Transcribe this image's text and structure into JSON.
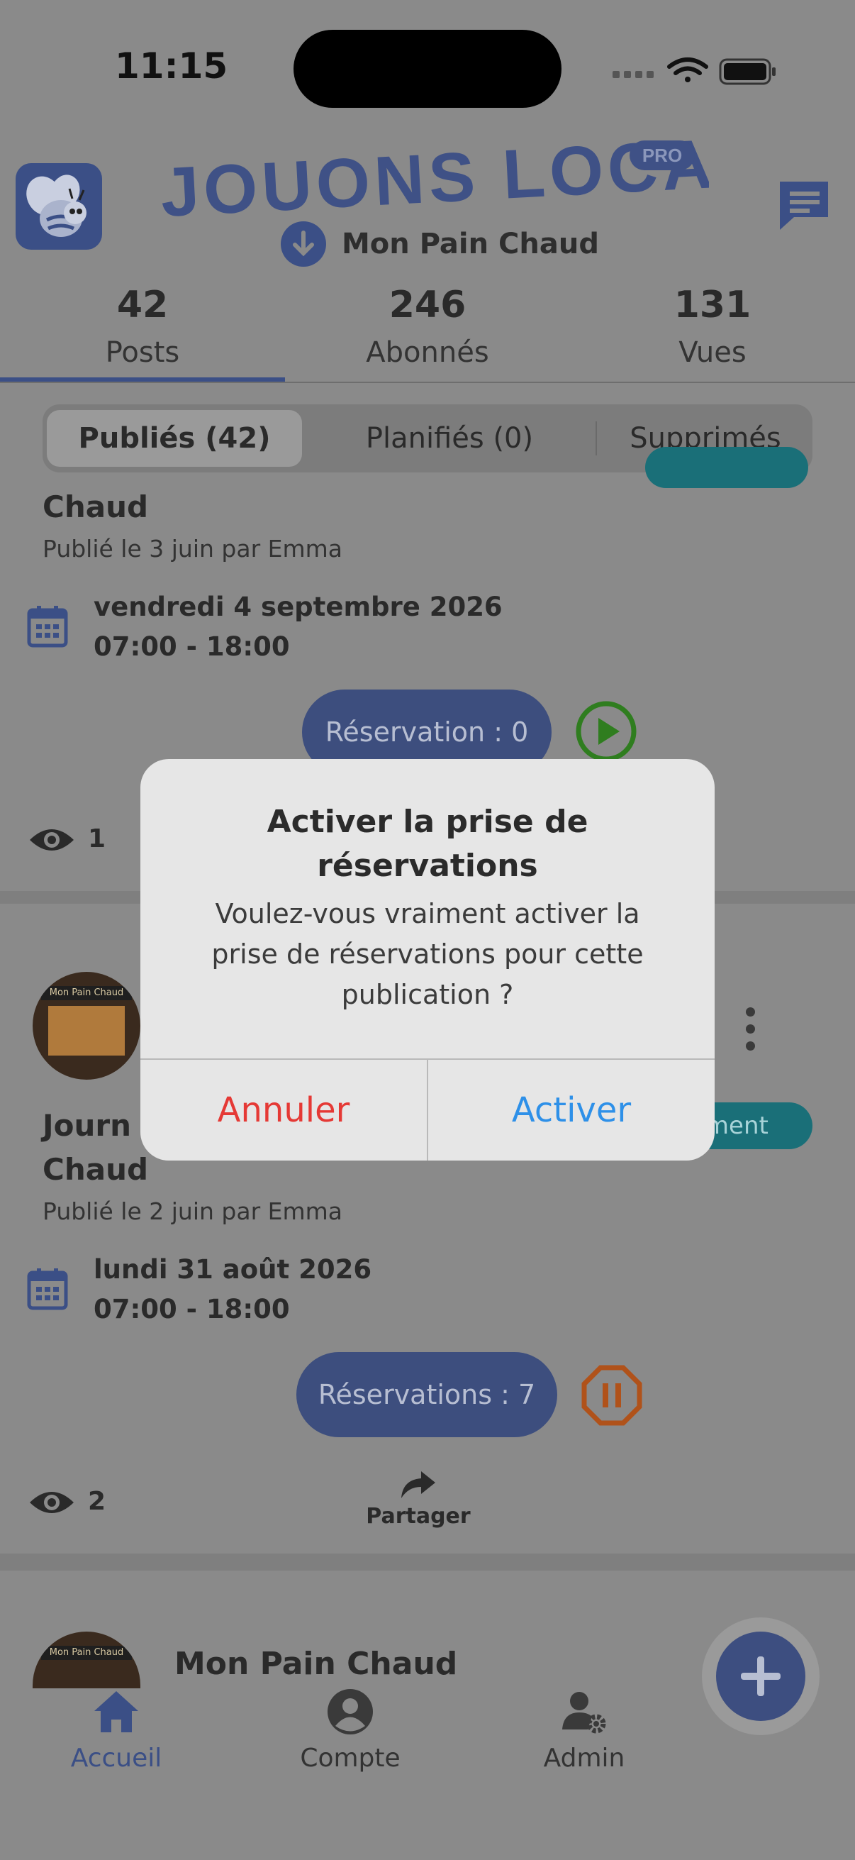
{
  "status_bar": {
    "time": "11:15"
  },
  "header": {
    "brand": "JOUONS LOCAL",
    "brand_badge": "PRO",
    "store_name": "Mon Pain Chaud"
  },
  "stats": [
    {
      "value": "42",
      "label": "Posts"
    },
    {
      "value": "246",
      "label": "Abonnés"
    },
    {
      "value": "131",
      "label": "Vues"
    }
  ],
  "segments": [
    {
      "label": "Publiés (42)",
      "active": true
    },
    {
      "label": "Planifiés (0)",
      "active": false
    },
    {
      "label": "Supprimés",
      "active": false
    }
  ],
  "posts": [
    {
      "title_visible": "Chaud",
      "meta": "Publié le 3 juin par Emma",
      "date": "vendredi 4 septembre 2026",
      "hours": "07:00 - 18:00",
      "reservation_label": "Réservation :  0",
      "views": "1"
    },
    {
      "title_line1": "Journ",
      "title_line2": "Chaud",
      "category_visible": "ement",
      "meta": "Publié le 2 juin par Emma",
      "date": "lundi 31 août 2026",
      "hours": "07:00 - 18:00",
      "reservation_label": "Réservations :  7",
      "views": "2",
      "share_label": "Partager"
    },
    {
      "author": "Mon Pain Chaud"
    }
  ],
  "tabbar": {
    "items": [
      {
        "label": "Accueil",
        "icon": "home-icon",
        "active": true
      },
      {
        "label": "Compte",
        "icon": "account-icon",
        "active": false
      },
      {
        "label": "Admin",
        "icon": "admin-icon",
        "active": false
      }
    ]
  },
  "dialog": {
    "title": "Activer la prise de réservations",
    "message": "Voulez-vous vraiment activer la prise de réservations pour cette publication ?",
    "cancel_label": "Annuler",
    "confirm_label": "Activer"
  },
  "colors": {
    "brand_blue": "#3b4f86",
    "teal": "#1a6f78",
    "play_green": "#2f7d1f",
    "pause_orange": "#b0521a",
    "cancel_red": "#e53935",
    "confirm_blue": "#2e90e8"
  }
}
